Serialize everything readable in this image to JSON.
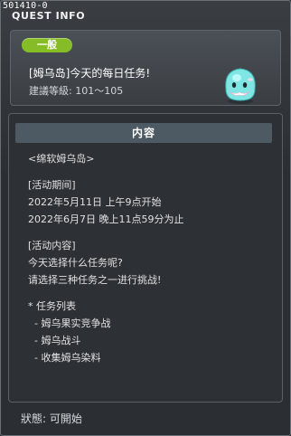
{
  "window": {
    "id_code": "501410-0",
    "title": "QUEST INFO"
  },
  "quest": {
    "badge": "一般",
    "name": "[姆乌岛]今天的每日任务!",
    "level": "建議等級: 101～105"
  },
  "content": {
    "header": "内容",
    "lines": [
      "<绵软姆乌岛>",
      "",
      "[活动期间]",
      "2022年5月11日 上午9点开始",
      "2022年6月7日 晚上11点59分为止",
      "",
      "[活动内容]",
      "今天选择什么任务呢?",
      "请选择三种任务之一进行挑战!",
      "",
      "* 任务列表",
      "  - 姆乌果实竞争战",
      "  - 姆乌战斗",
      "  - 收集姆乌染料"
    ]
  },
  "status": "狀態: 可開始",
  "colors": {
    "badge": "#86bd26",
    "content_header": "#4d5a63",
    "mascot_body": "#7fe6e3"
  },
  "icons": {
    "mascot": "pink-bean-style-mascot-icon"
  }
}
